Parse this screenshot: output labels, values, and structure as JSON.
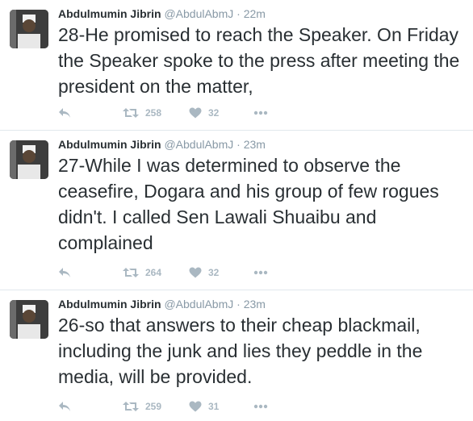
{
  "tweets": [
    {
      "name": "Abdulmumin Jibrin",
      "handle": "@AbdulAbmJ",
      "sep": "·",
      "time": "22m",
      "text": "28-He promised to reach the Speaker. On Friday the Speaker spoke to the press after meeting the president on the matter,",
      "retweets": "258",
      "likes": "32"
    },
    {
      "name": "Abdulmumin Jibrin",
      "handle": "@AbdulAbmJ",
      "sep": "·",
      "time": "23m",
      "text": "27-While I was determined to observe the ceasefire, Dogara and his group of few rogues didn't. I called Sen Lawali Shuaibu and complained",
      "retweets": "264",
      "likes": "32"
    },
    {
      "name": "Abdulmumin Jibrin",
      "handle": "@AbdulAbmJ",
      "sep": "·",
      "time": "23m",
      "text": "26-so that answers to their cheap blackmail, including the junk and lies they peddle in the media, will be provided.",
      "retweets": "259",
      "likes": "31"
    }
  ],
  "icons": {
    "reply": "reply-icon",
    "retweet": "retweet-icon",
    "like": "heart-icon",
    "more": "more-icon"
  },
  "colors": {
    "text": "#292f33",
    "meta": "#8899a6",
    "action": "#aab8c2",
    "divider": "#e1e8ed"
  }
}
